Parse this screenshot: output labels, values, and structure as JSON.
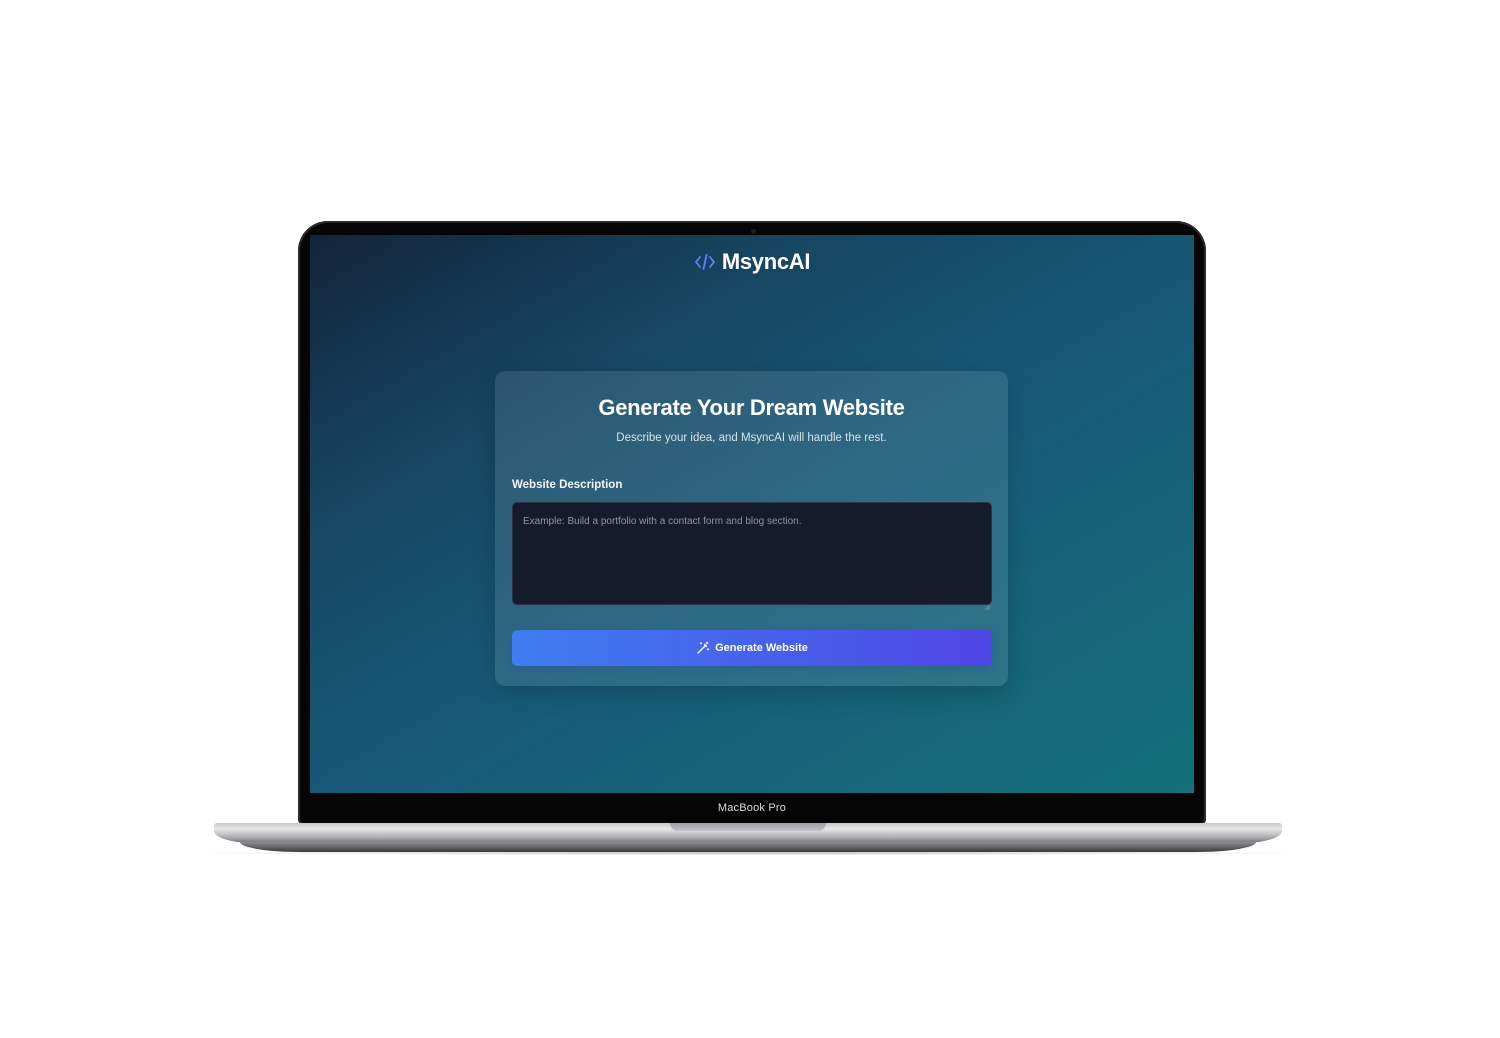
{
  "app": {
    "brand_name": "MsyncAI",
    "brand_icon": "code-brackets-icon",
    "accent_color": "#4f46e5",
    "brand_icon_color": "#6b7cff"
  },
  "card": {
    "title": "Generate Your Dream Website",
    "subtitle": "Describe your idea, and MsyncAI will handle the rest.",
    "field_label": "Website Description",
    "textarea_value": "",
    "textarea_placeholder": "Example: Build a portfolio with a contact form and blog section.",
    "button_label": "Generate Website",
    "button_icon": "magic-wand-icon"
  },
  "device": {
    "label": "MacBook Pro"
  }
}
